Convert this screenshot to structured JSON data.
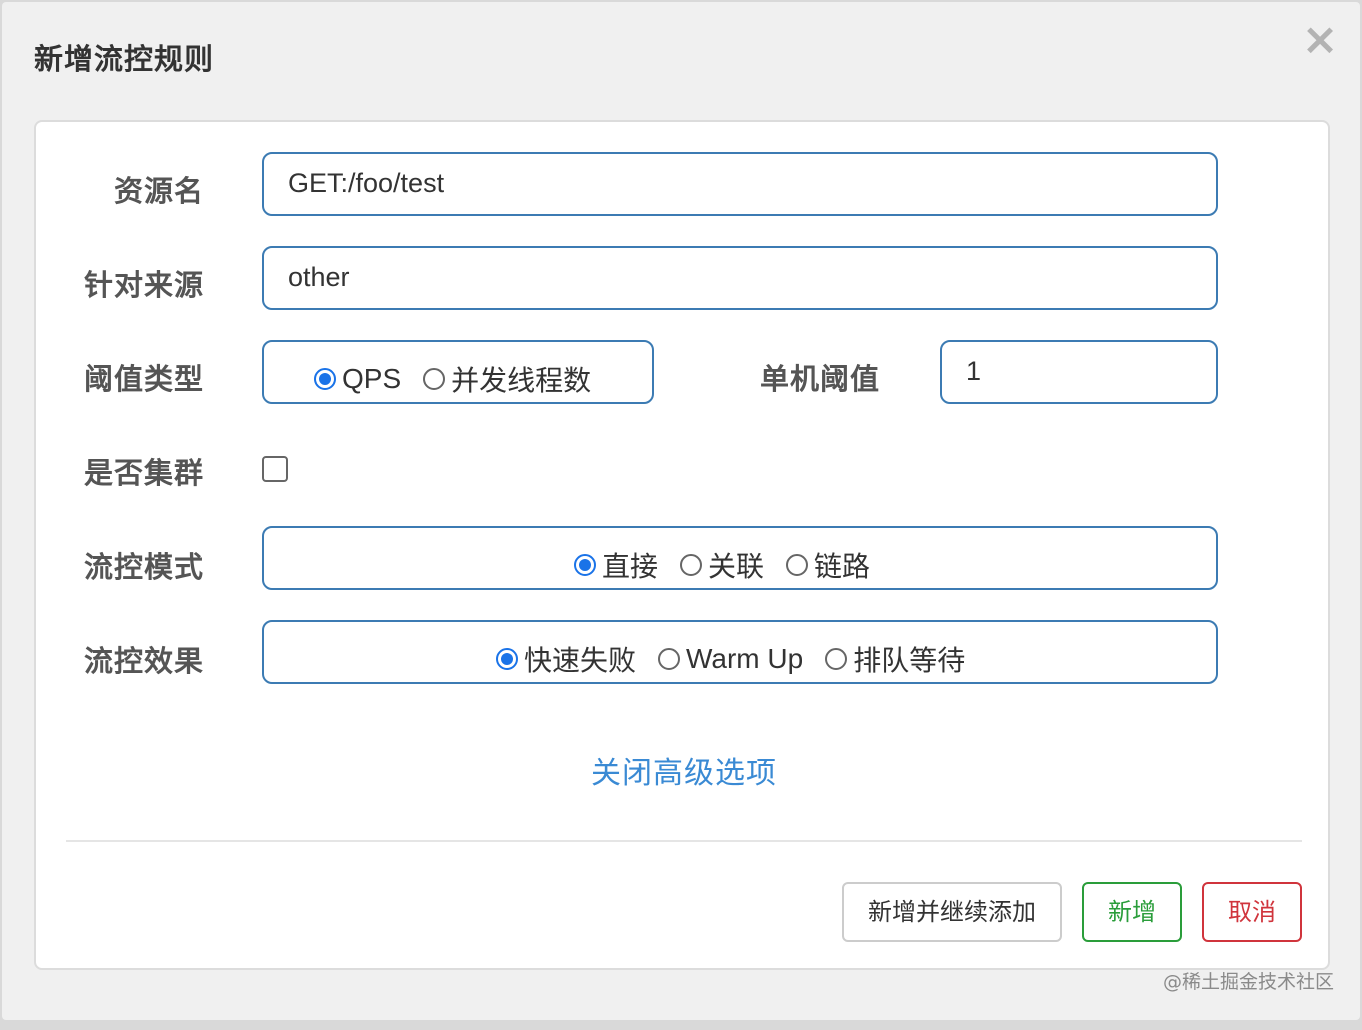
{
  "dialog": {
    "title": "新增流控规则",
    "close_symbol": "×"
  },
  "form": {
    "resource": {
      "label": "资源名",
      "value": "GET:/foo/test"
    },
    "origin": {
      "label": "针对来源",
      "value": "other"
    },
    "threshold_type": {
      "label": "阈值类型",
      "options": [
        "QPS",
        "并发线程数"
      ],
      "selected": "QPS"
    },
    "threshold": {
      "label": "单机阈值",
      "value": "1"
    },
    "cluster": {
      "label": "是否集群",
      "checked": false
    },
    "control_mode": {
      "label": "流控模式",
      "options": [
        "直接",
        "关联",
        "链路"
      ],
      "selected": "直接"
    },
    "control_effect": {
      "label": "流控效果",
      "options": [
        "快速失败",
        "Warm Up",
        "排队等待"
      ],
      "selected": "快速失败"
    },
    "advanced_link": "关闭高级选项"
  },
  "footer": {
    "add_continue": "新增并继续添加",
    "add": "新增",
    "cancel": "取消"
  },
  "watermark": "@稀土掘金技术社区",
  "colors": {
    "input_border": "#3c7bb3",
    "radio_selected": "#1a73e8",
    "link": "#3a8ad4",
    "add_button": "#2a9d3a",
    "cancel_button": "#d0343c"
  }
}
